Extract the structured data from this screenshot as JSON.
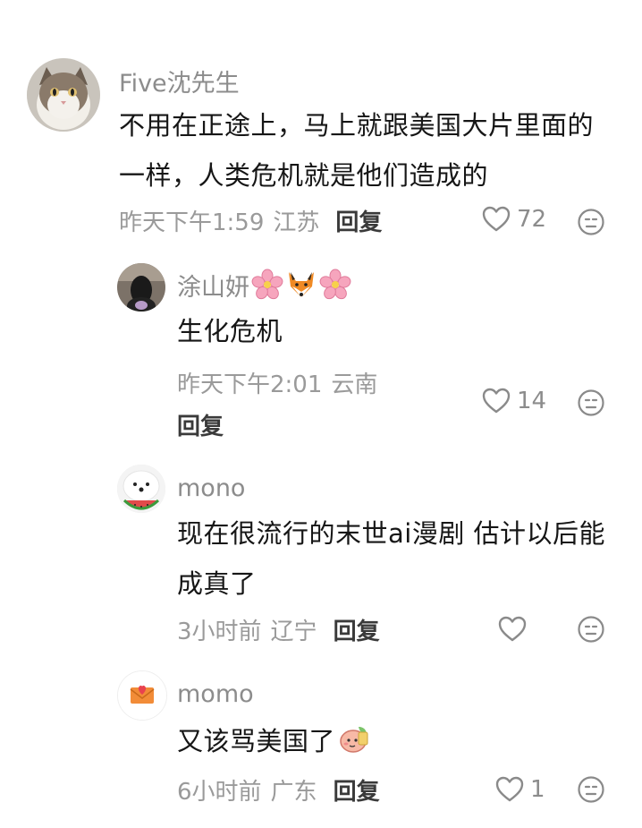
{
  "comments": [
    {
      "username": "Five沈先生",
      "text": "不用在正途上，马上就跟美国大片里面的一样，人类危机就是他们造成的",
      "time": "昨天下午1:59",
      "location": "江苏",
      "reply_label": "回复",
      "likes": "72",
      "avatar": "cat-avatar",
      "replies": [
        {
          "username": "涂山妍",
          "username_emojis": [
            "cherry-blossom-icon",
            "fox-icon",
            "cherry-blossom-icon"
          ],
          "text": "生化危机",
          "time": "昨天下午2:01",
          "location": "云南",
          "reply_label": "回复",
          "likes": "14",
          "avatar": "dark-portrait-avatar"
        },
        {
          "username": "mono",
          "text": "现在很流行的末世ai漫剧 估计以后能成真了",
          "time": "3小时前",
          "location": "辽宁",
          "reply_label": "回复",
          "likes": "",
          "avatar": "dog-watermelon-avatar"
        },
        {
          "username": "momo",
          "text": "又该骂美国了",
          "text_emoji": "peach-character-sticker-icon",
          "time": "6小时前",
          "location": "广东",
          "reply_label": "回复",
          "likes": "1",
          "avatar": "envelope-heart-avatar"
        }
      ]
    }
  ],
  "colors": {
    "username": "#8c8c8c",
    "text": "#161616",
    "meta": "#9a9a9a",
    "reply": "#3a3a3a",
    "icon": "#8a8a8a"
  }
}
